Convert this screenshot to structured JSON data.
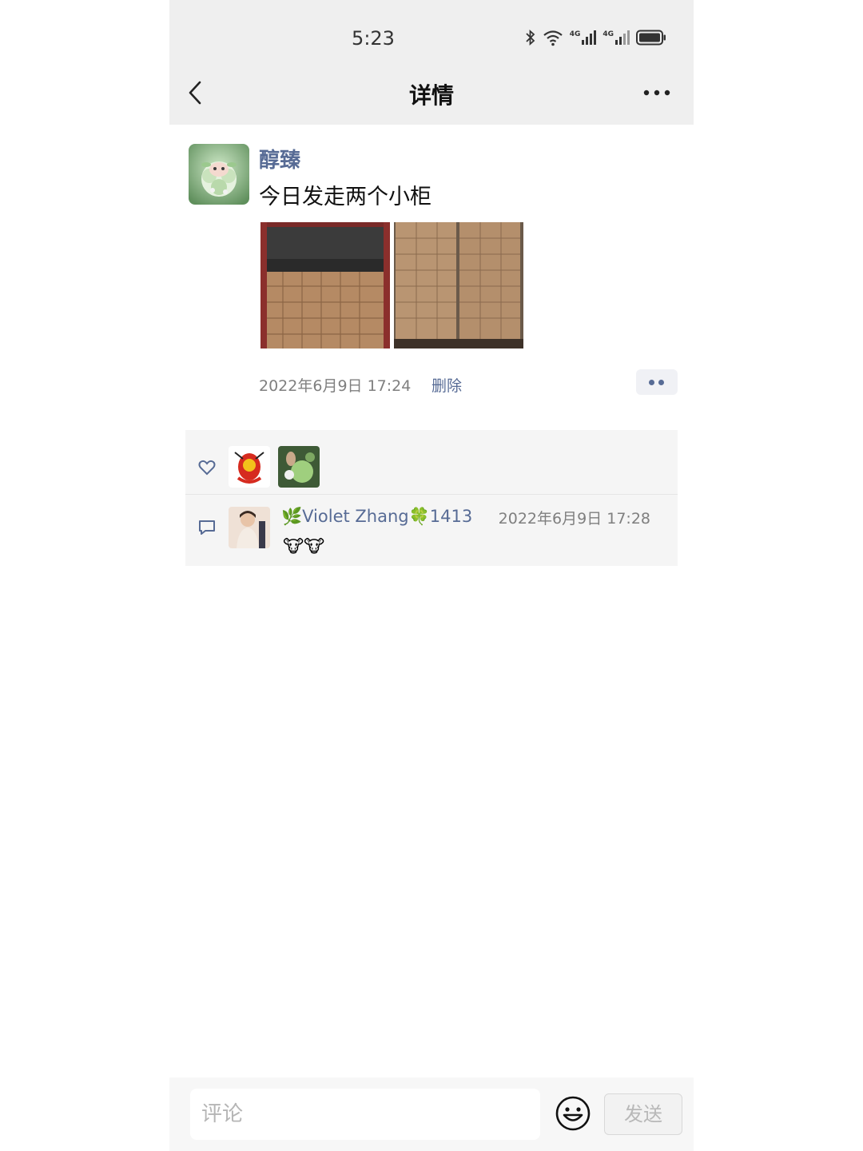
{
  "status_bar": {
    "time": "5:23",
    "icons": [
      "bluetooth-icon",
      "wifi-icon",
      "signal-4g-icon",
      "signal-4g-icon",
      "battery-icon"
    ],
    "signal_label_1": "4G",
    "signal_label_2": "4G"
  },
  "nav": {
    "title": "详情",
    "back_icon": "chevron-left-icon",
    "more_icon": "more-dots-icon"
  },
  "post": {
    "author": "醇臻",
    "text": "今日发走两个小柜",
    "timestamp": "2022年6月9日 17:24",
    "delete_label": "删除",
    "photos": [
      "container-boxes-photo",
      "pallet-boxes-photo"
    ]
  },
  "likes": {
    "icon": "heart-icon",
    "avatars": [
      "liker-avatar-1",
      "liker-avatar-2"
    ]
  },
  "comments": [
    {
      "author": "🌿Violet Zhang🍀1413",
      "time": "2022年6月9日 17:28",
      "text": "🐮🐮"
    }
  ],
  "composer": {
    "placeholder": "评论",
    "send_label": "发送",
    "emoji_icon": "smiley-icon"
  },
  "colors": {
    "link": "#576b95",
    "bar_bg": "#efefef",
    "panel_bg": "#f5f5f5"
  }
}
